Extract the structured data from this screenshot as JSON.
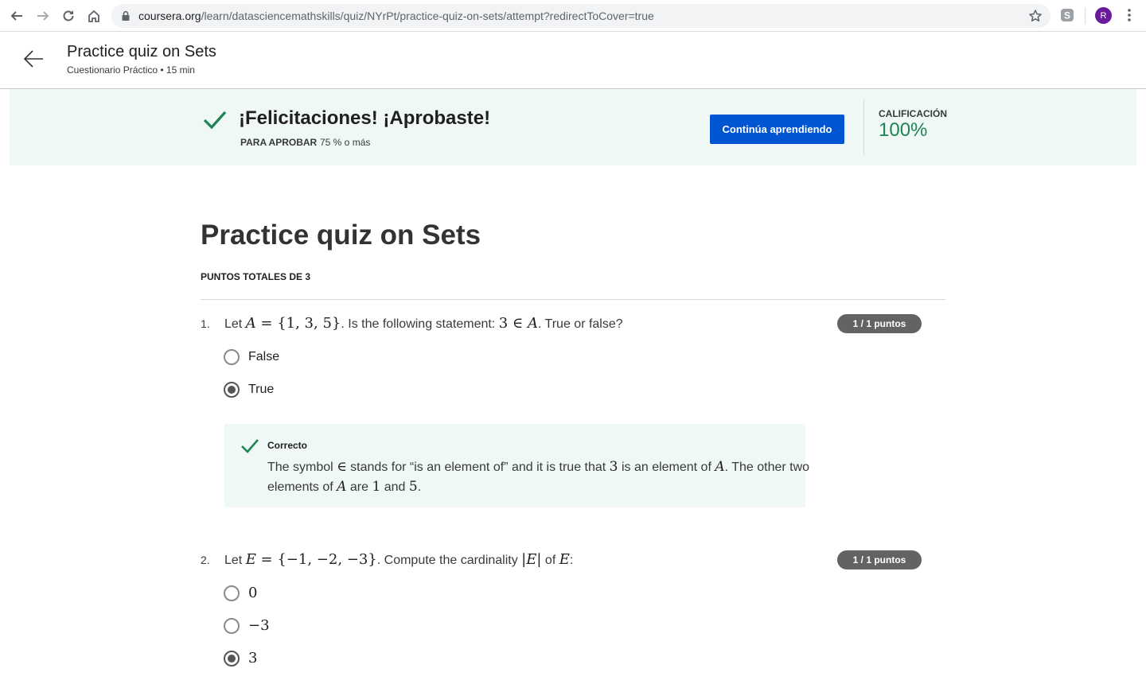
{
  "browser": {
    "url_host": "coursera.org",
    "url_path": "/learn/datasciencemathskills/quiz/NYrPt/practice-quiz-on-sets/attempt?redirectToCover=true",
    "avatar_letter": "R"
  },
  "header": {
    "title": "Practice quiz on Sets",
    "subtitle": "Cuestionario Práctico • 15 min"
  },
  "banner": {
    "congrats": "¡Felicitaciones! ¡Aprobaste!",
    "pass_label": "PARA APROBAR",
    "pass_value": "75 % o más",
    "continue_label": "Continúa aprendiendo",
    "grade_label": "CALIFICACIÓN",
    "grade_value": "100%",
    "accent_color": "#1f8354",
    "button_color": "#0056d2"
  },
  "quiz": {
    "title": "Practice quiz on Sets",
    "points_total": "PUNTOS TOTALES DE 3",
    "questions": [
      {
        "number": "1.",
        "badge": "1 / 1 puntos",
        "text": {
          "t1": "Let ",
          "m1": "A",
          "m2": " = {1, 3, 5}",
          "t2": ". Is the following statement: ",
          "m3": "3 ∈ ",
          "m4": "A",
          "t3": ". True or false?"
        },
        "options": [
          {
            "label": "False",
            "selected": false
          },
          {
            "label": "True",
            "selected": true
          }
        ],
        "feedback": {
          "title": "Correcto",
          "parts": {
            "p1": "The symbol ",
            "s1": "∈",
            "p2": " stands for “is an element of” and it is true that ",
            "s2": "3",
            "p3": " is an element of ",
            "s3": "A",
            "p4": ". The other two elements of ",
            "s4": "A",
            "p5": " are ",
            "s5": "1",
            "p6": " and ",
            "s6": "5",
            "p7": "."
          }
        }
      },
      {
        "number": "2.",
        "badge": "1 / 1 puntos",
        "text": {
          "t1": "Let ",
          "m1": "E",
          "m2": " = {−1, −2, −3}",
          "t2": ". Compute the cardinality ",
          "m3": "|",
          "m4": "E",
          "m5": "|",
          "t3": " of ",
          "m6": "E",
          "t4": ":"
        },
        "options": [
          {
            "label": "0",
            "selected": false
          },
          {
            "label": "−3",
            "selected": false
          },
          {
            "label": "3",
            "selected": true
          }
        ]
      }
    ]
  }
}
